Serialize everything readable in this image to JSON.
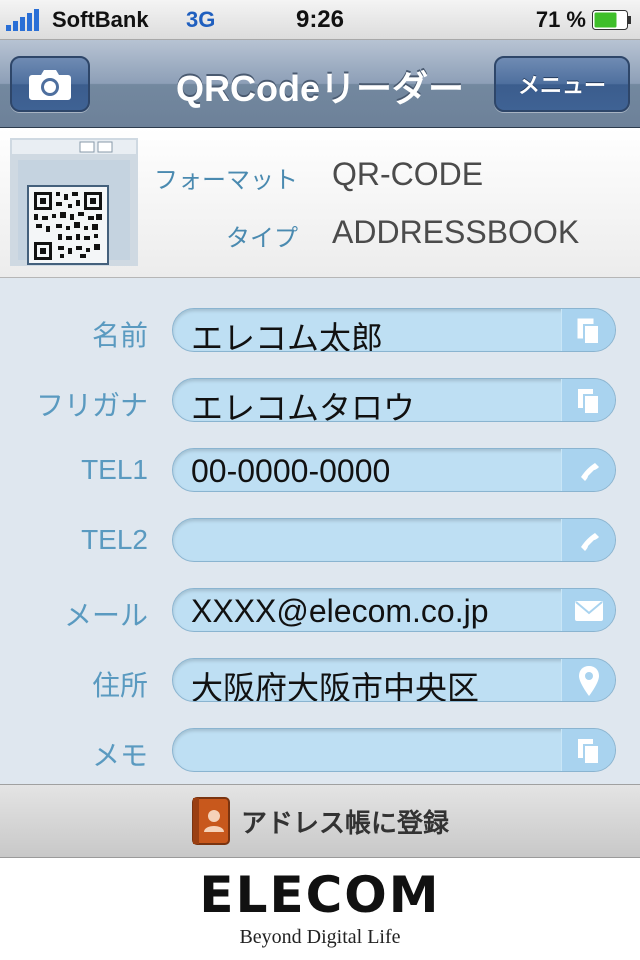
{
  "status_bar": {
    "carrier": "SoftBank",
    "network": "3G",
    "time": "9:26",
    "battery_percent": "71 %",
    "battery_level": 0.71
  },
  "nav": {
    "title": "QRCodeリーダー",
    "menu_label": "メニュー",
    "camera_icon": "camera-icon"
  },
  "scan_info": {
    "format_label": "フォーマット",
    "format_value": "QR-CODE",
    "type_label": "タイプ",
    "type_value": "ADDRESSBOOK"
  },
  "fields": [
    {
      "label": "名前",
      "value": "エレコム太郎",
      "icon": "copy-icon"
    },
    {
      "label": "フリガナ",
      "value": "エレコムタロウ",
      "icon": "copy-icon"
    },
    {
      "label": "TEL1",
      "value": "00-0000-0000",
      "icon": "phone-icon"
    },
    {
      "label": "TEL2",
      "value": "",
      "icon": "phone-icon"
    },
    {
      "label": "メール",
      "value": "XXXX@elecom.co.jp",
      "icon": "mail-icon"
    },
    {
      "label": "住所",
      "value": "大阪府大阪市中央区",
      "icon": "map-pin-icon"
    },
    {
      "label": "メモ",
      "value": "",
      "icon": "copy-icon"
    }
  ],
  "register": {
    "label": "アドレス帳に登録",
    "icon": "address-book-icon"
  },
  "footer": {
    "brand": "ELECOM",
    "tagline": "Beyond Digital Life"
  },
  "colors": {
    "nav_bar": "#8d9fb7",
    "label_blue": "#5a9ac0",
    "field_fill": "#bedff3",
    "network_blue": "#1f5fbf",
    "battery_green": "#3fbf2a",
    "book_orange": "#c8581c"
  }
}
